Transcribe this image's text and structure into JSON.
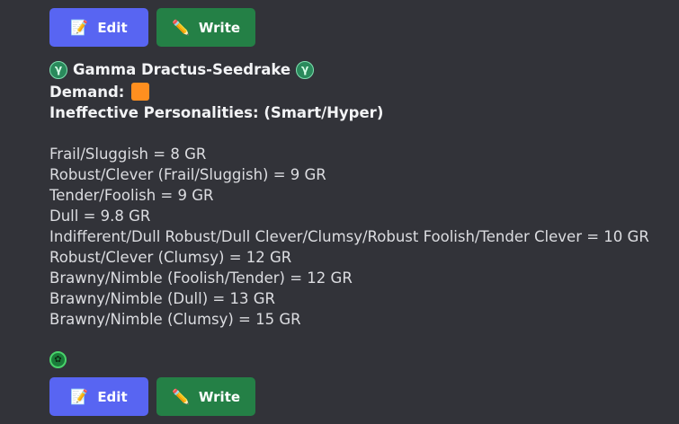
{
  "buttons": {
    "edit_label": "Edit",
    "write_label": "Write",
    "edit_icon": "memo-icon",
    "write_icon": "pencil-icon",
    "edit_color": "#5865f2",
    "write_color": "#248046"
  },
  "post": {
    "title": "Gamma Dractus-Seedrake",
    "title_icon": "gamma-icon",
    "demand_label": "Demand:",
    "demand_color": "#ff8f1f",
    "ineffective_label": "Ineffective Personalities: (Smart/Hyper)",
    "prices": [
      "Frail/Sluggish = 8 GR",
      "Robust/Clever (Frail/Sluggish) = 9 GR",
      "Tender/Foolish = 9 GR",
      "Dull = 9.8 GR",
      "Indifferent/Dull Robust/Dull Clever/Clumsy/Robust Foolish/Tender Clever = 10 GR",
      "Robust/Clever (Clumsy) = 12 GR",
      "Brawny/Nimble (Foolish/Tender) = 12 GR",
      "Brawny/Nimble (Dull) = 13 GR",
      "Brawny/Nimble (Clumsy) = 15 GR"
    ]
  },
  "emblem_icon": "green-badge-icon"
}
